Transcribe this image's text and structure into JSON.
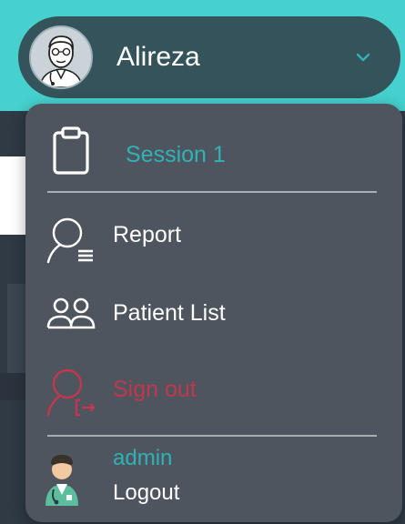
{
  "user": {
    "name": "Alireza",
    "avatar_icon": "doctor-avatar",
    "expand_icon": "chevron-down-icon"
  },
  "menu": {
    "items": [
      {
        "label": "Session 1",
        "icon": "clipboard-icon",
        "color": "#2fb3b6"
      },
      {
        "label": "Report",
        "icon": "report-icon",
        "color": "#ffffff"
      },
      {
        "label": "Patient List",
        "icon": "patients-icon",
        "color": "#ffffff"
      },
      {
        "label": "Sign out",
        "icon": "sign-out-icon",
        "color": "#c2374d"
      }
    ],
    "account": {
      "role": "admin",
      "logout_label": "Logout",
      "icon": "doctor-icon"
    }
  },
  "colors": {
    "accent_teal": "#2fb3b6",
    "danger": "#c2374d",
    "menu_bg": "#4e555e",
    "header_bg": "#46d1cf"
  }
}
